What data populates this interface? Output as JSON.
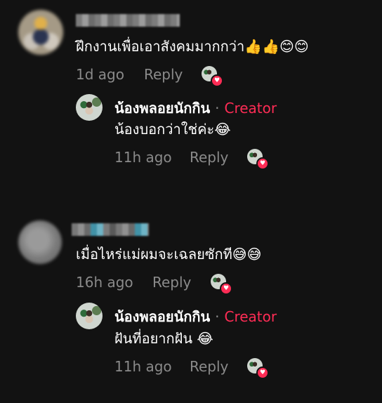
{
  "comments": [
    {
      "text": "ฝึกงานเพื่อเอาสังคมมากกว่า👍👍😊😊",
      "time": "1d ago",
      "reply_label": "Reply",
      "reply": {
        "author": "น้องพลอยนักกิน",
        "separator": "·",
        "badge": "Creator",
        "text": "น้องบอกว่าใช่ค่ะ😂",
        "time": "11h ago",
        "reply_label": "Reply"
      }
    },
    {
      "text": "เมื่อไหร่แม่ผมจะเฉลยซักที😅😅",
      "time": "16h ago",
      "reply_label": "Reply",
      "reply": {
        "author": "น้องพลอยนักกิน",
        "separator": "·",
        "badge": "Creator",
        "text": "ฝันที่อยากฝัน 😂",
        "time": "11h ago",
        "reply_label": "Reply"
      }
    }
  ],
  "colors": {
    "background": "#121212",
    "creator_badge": "#fe2c55",
    "meta_text": "#8a8a8a",
    "heart": "#fe2c55"
  },
  "icons": {
    "liked_by_creator": "heart-icon"
  }
}
